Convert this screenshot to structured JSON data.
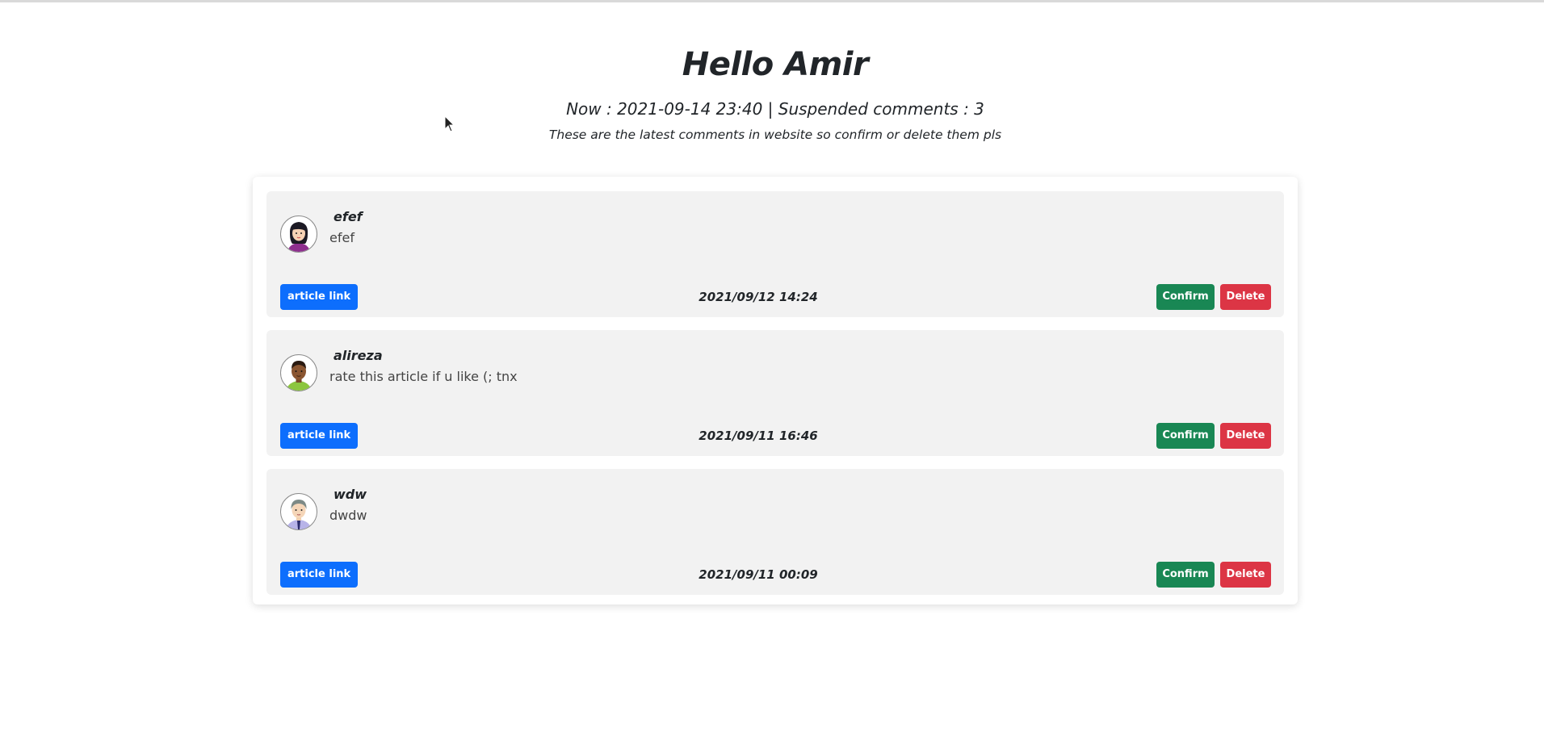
{
  "header": {
    "title": "Hello Amir",
    "subtitle": "Now : 2021-09-14 23:40 | Suspended comments : 3",
    "description": "These are the latest comments in website so confirm or delete them pls"
  },
  "comments": [
    {
      "author": "efef",
      "text": "efef",
      "date": "2021/09/12 14:24",
      "link_label": "article link",
      "confirm_label": "Confirm",
      "delete_label": "Delete",
      "avatar": "female-avatar-icon"
    },
    {
      "author": "alireza",
      "text": "rate this article if u like (; tnx",
      "date": "2021/09/11 16:46",
      "link_label": "article link",
      "confirm_label": "Confirm",
      "delete_label": "Delete",
      "avatar": "male-avatar-icon"
    },
    {
      "author": "wdw",
      "text": "dwdw",
      "date": "2021/09/11 00:09",
      "link_label": "article link",
      "confirm_label": "Confirm",
      "delete_label": "Delete",
      "avatar": "elder-avatar-icon"
    }
  ],
  "colors": {
    "link_button": "#0d6efd",
    "confirm_button": "#198754",
    "delete_button": "#dc3545",
    "comment_bg": "#f2f2f2"
  }
}
